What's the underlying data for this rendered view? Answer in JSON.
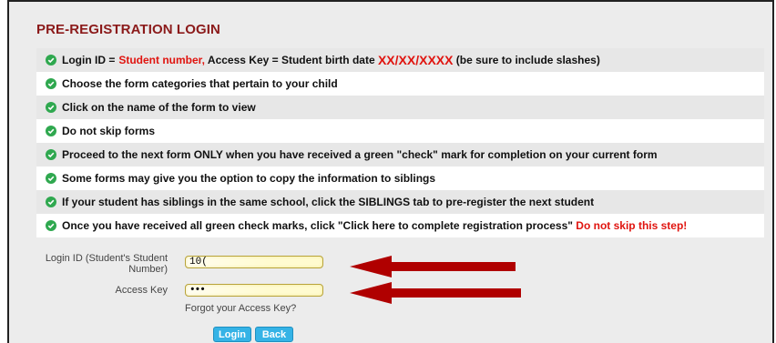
{
  "page_title": "PRE-REGISTRATION LOGIN",
  "instructions": [
    {
      "prefix": "Login ID = ",
      "red1": "Student number,",
      "middle": " Access Key = Student birth date ",
      "red2": "XX/XX/XXXX",
      "suffix": " (be sure to include slashes)"
    },
    {
      "text": "Choose the form categories that pertain to your child"
    },
    {
      "text": "Click on the name of the form to view"
    },
    {
      "text": "Do not skip forms"
    },
    {
      "text": "Proceed to the next form ONLY when you have received a green \"check\" mark for completion on your current form"
    },
    {
      "text": "Some forms may give you the option to copy the information to siblings"
    },
    {
      "text": "If your student has siblings in the same school, click the SIBLINGS tab to pre-register the next student"
    },
    {
      "text": "Once you have received all green check marks, click \"Click here to complete registration process\" ",
      "red": "Do not skip this step!"
    }
  ],
  "login": {
    "login_id_label": "Login ID (Student's Student Number)",
    "login_id_value": "10(",
    "access_key_label": "Access Key",
    "access_key_value": "•••",
    "forgot_link": "Forgot your Access Key?",
    "login_button": "Login",
    "back_button": "Back"
  },
  "colors": {
    "title": "#8b1a1a",
    "accent_red": "#e0140f",
    "check_green": "#2fa84f",
    "button_blue": "#35b3e6",
    "arrow_red": "#b00000"
  }
}
